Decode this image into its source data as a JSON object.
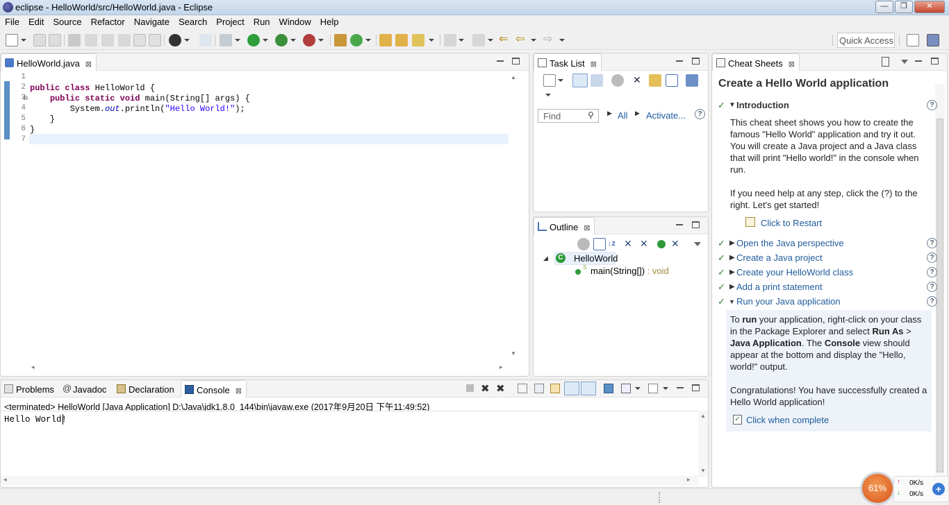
{
  "window": {
    "title": "eclipse - HelloWorld/src/HelloWorld.java - Eclipse"
  },
  "menu": [
    "File",
    "Edit",
    "Source",
    "Refactor",
    "Navigate",
    "Search",
    "Project",
    "Run",
    "Window",
    "Help"
  ],
  "quick_access": "Quick Access",
  "editor": {
    "tab": "HelloWorld.java",
    "line_numbers": [
      "1",
      "2",
      "3",
      "4",
      "5",
      "6",
      "7"
    ],
    "code": {
      "l2a": "public class",
      "l2b": " HelloWorld {",
      "l3a": "    ",
      "l3b": "public static void",
      "l3c": " main(String[] args) {",
      "l4a": "        System.",
      "l4b": "out",
      "l4c": ".println(",
      "l4d": "\"Hello World!\"",
      "l4e": ");",
      "l5": "    }",
      "l6": "}"
    }
  },
  "tasklist": {
    "tab": "Task List",
    "find_placeholder": "Find",
    "all": "All",
    "activate": "Activate..."
  },
  "outline": {
    "tab": "Outline",
    "class_name": "HelloWorld",
    "method": "main(String[])",
    "method_type": " : void",
    "static_marker": "S"
  },
  "cheatsheet": {
    "tab": "Cheat Sheets",
    "title": "Create a Hello World application",
    "intro_title": "Introduction",
    "intro_p1": "This cheat sheet shows you how to create the famous \"Hello World\" application and try it out. You will create a Java project and a Java class that will print \"Hello world!\" in the console when run.",
    "intro_p2": "If you need help at any step, click the (?) to the right. Let's get started!",
    "restart": "Click to Restart",
    "steps": [
      "Open the Java perspective",
      "Create a Java project",
      "Create your HelloWorld class",
      "Add a print statement",
      "Run your Java application"
    ],
    "run": {
      "t1": "To ",
      "b1": "run",
      "t2": " your application, right-click on your class in the Package Explorer and select ",
      "b2": "Run As",
      "t3": " > ",
      "b3": "Java Application",
      "t4": ". The ",
      "b4": "Console",
      "t5": " view should appear at the bottom and display the \"Hello, world!\" output."
    },
    "congrats": "Congratulations! You have successfully created a Hello World application!",
    "complete": "Click when complete"
  },
  "console": {
    "tabs": [
      "Problems",
      "Javadoc",
      "Declaration",
      "Console"
    ],
    "header": "<terminated> HelloWorld [Java Application] D:\\Java\\jdk1.8.0_144\\bin\\javaw.exe (2017年9月20日 下午11:49:52)",
    "output": "Hello World!"
  },
  "net_widget": {
    "percent": "61%",
    "up": "0K/s",
    "down": "0K/s"
  },
  "colors": {
    "keyword": "#7f0055",
    "string": "#2a00ff",
    "static_field": "#0000c0",
    "link": "#1f5b9c",
    "check": "#2b7a2b"
  }
}
